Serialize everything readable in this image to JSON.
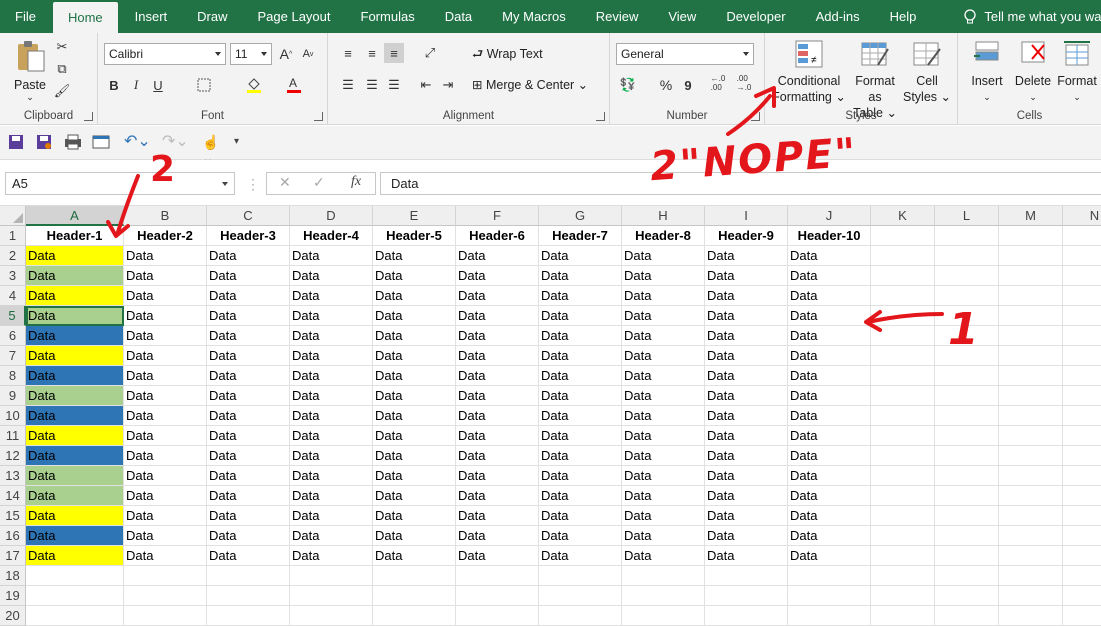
{
  "menu": {
    "tabs": [
      "File",
      "Home",
      "Insert",
      "Draw",
      "Page Layout",
      "Formulas",
      "Data",
      "My Macros",
      "Review",
      "View",
      "Developer",
      "Add-ins",
      "Help"
    ],
    "active": "Home",
    "tell_me": "Tell me what you want to do"
  },
  "ribbon": {
    "clipboard": {
      "label": "Clipboard",
      "paste": "Paste"
    },
    "font": {
      "label": "Font",
      "name": "Calibri",
      "size": "11",
      "bold": "B",
      "italic": "I",
      "underline": "U",
      "grow": "A",
      "shrink": "A"
    },
    "alignment": {
      "label": "Alignment",
      "wrap": "Wrap Text",
      "merge": "Merge & Center"
    },
    "number": {
      "label": "Number",
      "format": "General",
      "percent": "%",
      "comma": "9",
      "inc": "←.0\n.00",
      "dec": ".00\n→.0"
    },
    "styles": {
      "label": "Styles",
      "cond1": "Conditional",
      "cond2": "Formatting",
      "fmt1": "Format as",
      "fmt2": "Table",
      "cell1": "Cell",
      "cell2": "Styles"
    },
    "cells": {
      "label": "Cells",
      "insert": "Insert",
      "delete": "Delete",
      "format": "Format"
    }
  },
  "formula_bar": {
    "name_box": "A5",
    "fx": "fx",
    "value": "Data"
  },
  "grid": {
    "columns": [
      "A",
      "B",
      "C",
      "D",
      "E",
      "F",
      "G",
      "H",
      "I",
      "J",
      "K",
      "L",
      "M",
      "N"
    ],
    "rows": [
      "1",
      "2",
      "3",
      "4",
      "5",
      "6",
      "7",
      "8",
      "9",
      "10",
      "11",
      "12",
      "13",
      "14",
      "15",
      "16",
      "17",
      "18",
      "19",
      "20"
    ],
    "headers": [
      "Header-1",
      "Header-2",
      "Header-3",
      "Header-4",
      "Header-5",
      "Header-6",
      "Header-7",
      "Header-8",
      "Header-9",
      "Header-10"
    ],
    "cell_text": "Data",
    "column_a_fills": [
      "yellow",
      "green",
      "yellow",
      "green",
      "blue",
      "yellow",
      "blue",
      "green",
      "blue",
      "yellow",
      "blue",
      "green",
      "green",
      "yellow",
      "blue",
      "yellow"
    ],
    "fill_colors": {
      "yellow": "#ffff00",
      "green": "#a9d08e",
      "blue": "#2e75b6"
    },
    "selected_cell": "A5"
  },
  "annotations": {
    "nope_label": "2\"NOPE\"",
    "num_2": "2",
    "num_1": "1"
  },
  "colors": {
    "excel_green": "#217346",
    "annotation_red": "#e3171b"
  }
}
